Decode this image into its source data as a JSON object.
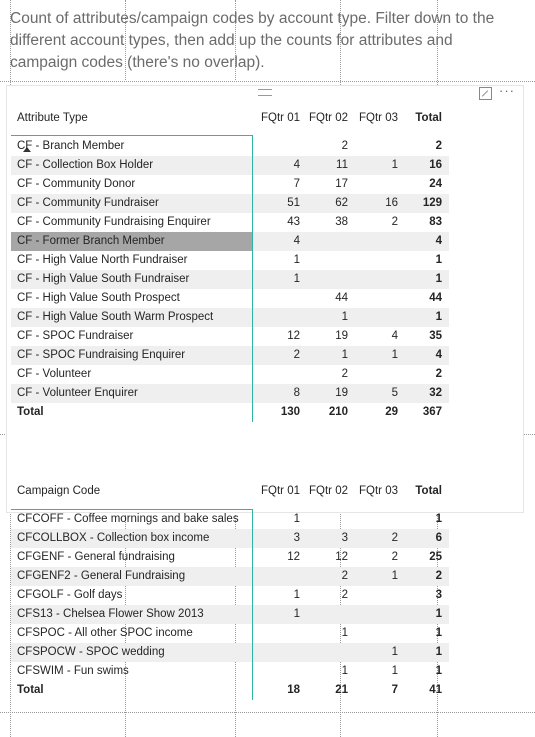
{
  "description": "Count of attributes/campaign codes by account type. Filter down to the different account types, then add up the counts for attributes and campaign codes (there's no overlap).",
  "visual_header": {
    "drag_icon": "grip-lines-icon",
    "focus_icon": "focus-mode-icon",
    "more_icon": "more-options-icon",
    "more_label": "···"
  },
  "colors": {
    "accent": "#2fb6a2",
    "row_alt": "#efefef",
    "selected": "#a6a6a6"
  },
  "attribute_table": {
    "columns": [
      "Attribute Type",
      "FQtr 01",
      "FQtr 02",
      "FQtr 03",
      "Total"
    ],
    "rows": [
      [
        "CF - Branch Member",
        "",
        "2",
        "",
        "2"
      ],
      [
        "CF - Collection Box Holder",
        "4",
        "11",
        "1",
        "16"
      ],
      [
        "CF - Community Donor",
        "7",
        "17",
        "",
        "24"
      ],
      [
        "CF - Community Fundraiser",
        "51",
        "62",
        "16",
        "129"
      ],
      [
        "CF - Community Fundraising Enquirer",
        "43",
        "38",
        "2",
        "83"
      ],
      [
        "CF - Former Branch Member",
        "4",
        "",
        "",
        "4"
      ],
      [
        "CF - High Value North Fundraiser",
        "1",
        "",
        "",
        "1"
      ],
      [
        "CF - High Value South Fundraiser",
        "1",
        "",
        "",
        "1"
      ],
      [
        "CF - High Value South Prospect",
        "",
        "44",
        "",
        "44"
      ],
      [
        "CF - High Value South Warm Prospect",
        "",
        "1",
        "",
        "1"
      ],
      [
        "CF - SPOC Fundraiser",
        "12",
        "19",
        "4",
        "35"
      ],
      [
        "CF - SPOC Fundraising Enquirer",
        "2",
        "1",
        "1",
        "4"
      ],
      [
        "CF - Volunteer",
        "",
        "2",
        "",
        "2"
      ],
      [
        "CF - Volunteer Enquirer",
        "8",
        "19",
        "5",
        "32"
      ]
    ],
    "selected_row": 5,
    "total": [
      "Total",
      "130",
      "210",
      "29",
      "367"
    ]
  },
  "campaign_table": {
    "columns": [
      "Campaign Code",
      "FQtr 01",
      "FQtr 02",
      "FQtr 03",
      "Total"
    ],
    "rows": [
      [
        "CFCOFF - Coffee mornings and bake sales",
        "1",
        "",
        "",
        "1"
      ],
      [
        "CFCOLLBOX - Collection box income",
        "3",
        "3",
        "2",
        "6"
      ],
      [
        "CFGENF - General fundraising",
        "12",
        "12",
        "2",
        "25"
      ],
      [
        "CFGENF2 - General Fundraising",
        "",
        "2",
        "1",
        "2"
      ],
      [
        "CFGOLF - Golf days",
        "1",
        "2",
        "",
        "3"
      ],
      [
        "CFS13 - Chelsea Flower Show 2013",
        "1",
        "",
        "",
        "1"
      ],
      [
        "CFSPOC - All other SPOC income",
        "",
        "1",
        "",
        "1"
      ],
      [
        "CFSPOCW - SPOC wedding",
        "",
        "",
        "1",
        "1"
      ],
      [
        "CFSWIM - Fun swims",
        "",
        "1",
        "1",
        "1"
      ]
    ],
    "total": [
      "Total",
      "18",
      "21",
      "7",
      "41"
    ]
  }
}
